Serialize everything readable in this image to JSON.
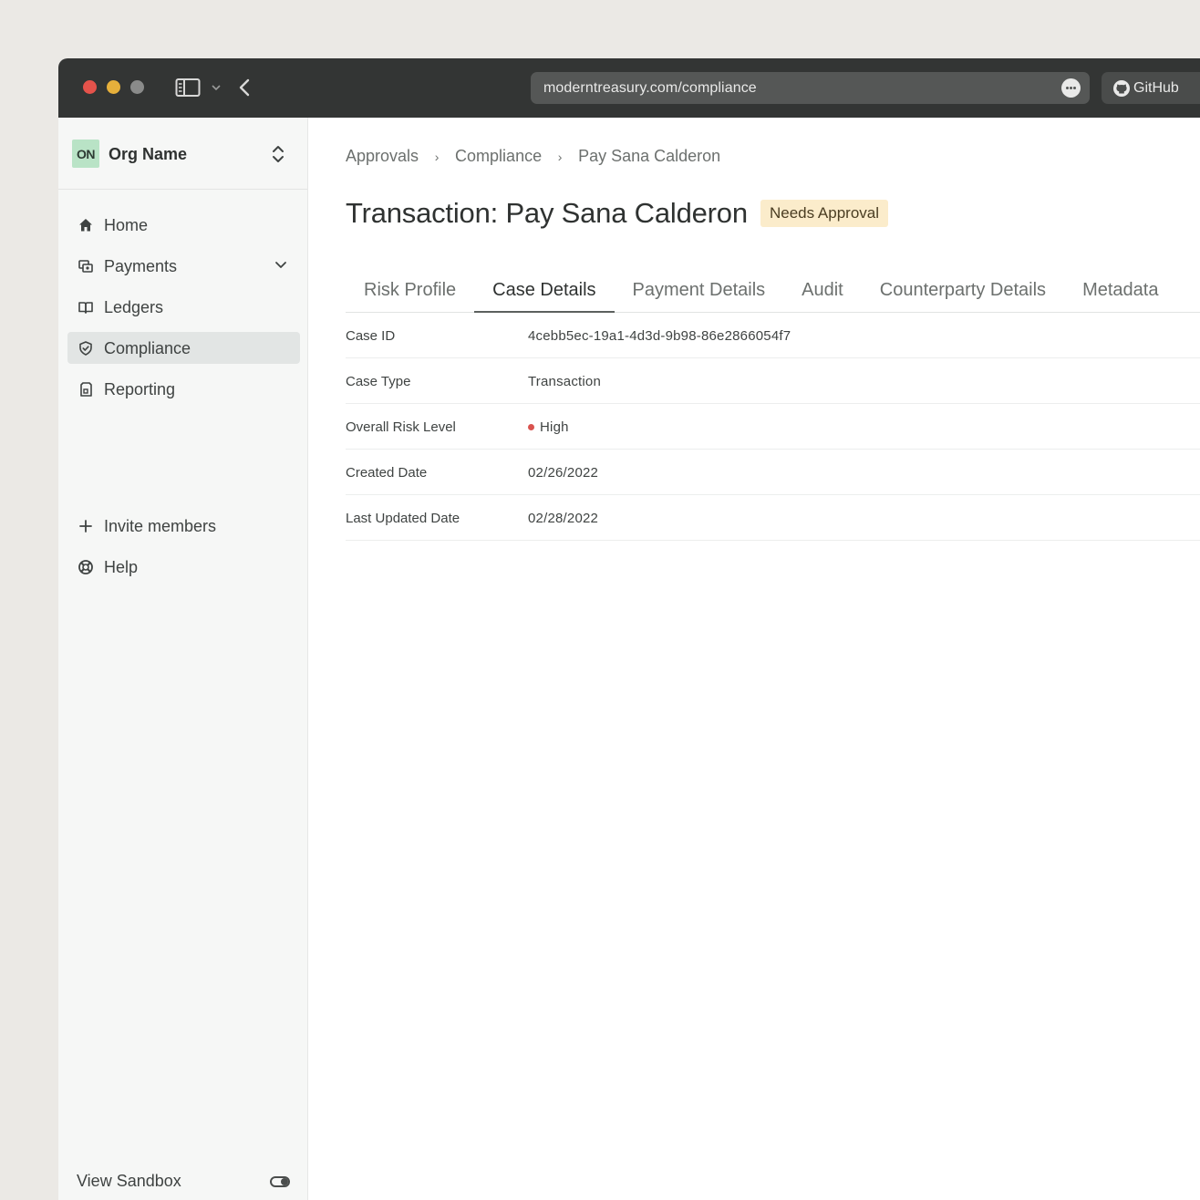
{
  "browser": {
    "url": "moderntreasury.com/compliance",
    "github_label": "GitHub"
  },
  "sidebar": {
    "org_initials": "ON",
    "org_name": "Org Name",
    "items": [
      {
        "label": "Home",
        "icon": "home-icon"
      },
      {
        "label": "Payments",
        "icon": "payments-icon"
      },
      {
        "label": "Ledgers",
        "icon": "book-icon"
      },
      {
        "label": "Compliance",
        "icon": "shield-icon",
        "active": true
      },
      {
        "label": "Reporting",
        "icon": "report-icon"
      }
    ],
    "secondary": [
      {
        "label": "Invite members",
        "icon": "plus-icon"
      },
      {
        "label": "Help",
        "icon": "help-icon"
      }
    ],
    "sandbox_label": "View Sandbox"
  },
  "breadcrumb": [
    "Approvals",
    "Compliance",
    "Pay Sana Calderon"
  ],
  "page": {
    "title": "Transaction: Pay Sana Calderon",
    "status": "Needs Approval"
  },
  "tabs": [
    "Risk Profile",
    "Case Details",
    "Payment Details",
    "Audit",
    "Counterparty Details",
    "Metadata"
  ],
  "active_tab": "Case Details",
  "details": [
    {
      "label": "Case ID",
      "value": "4cebb5ec-19a1-4d3d-9b98-86e2866054f7"
    },
    {
      "label": "Case Type",
      "value": "Transaction"
    },
    {
      "label": "Overall Risk Level",
      "value": "High"
    },
    {
      "label": "Created Date",
      "value": "02/26/2022"
    },
    {
      "label": "Last Updated Date",
      "value": "02/28/2022"
    }
  ],
  "colors": {
    "risk_high": "#d9534f",
    "status_badge_bg": "#fbeccb",
    "org_badge_bg": "#b9e3c6"
  }
}
